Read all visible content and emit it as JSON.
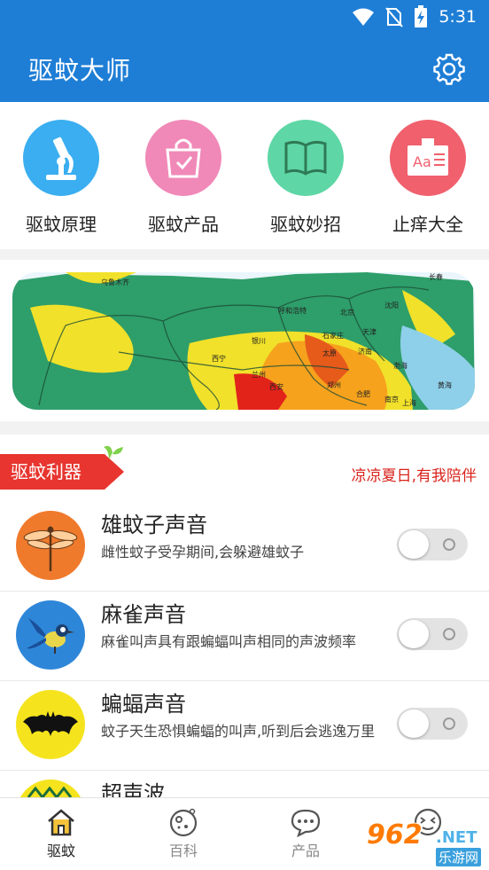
{
  "status": {
    "time": "5:31"
  },
  "app": {
    "title": "驱蚊大师"
  },
  "quick": [
    {
      "label": "驱蚊原理",
      "icon": "microscope-icon",
      "color": "#3aaef0"
    },
    {
      "label": "驱蚊产品",
      "icon": "shopping-bag-icon",
      "color": "#f089b8"
    },
    {
      "label": "驱蚊妙招",
      "icon": "book-icon",
      "color": "#5fd6a6"
    },
    {
      "label": "止痒大全",
      "icon": "text-card-icon",
      "color": "#f0606d"
    }
  ],
  "banner": {
    "labels": [
      "乌鲁木齐",
      "呼和浩特",
      "北京",
      "沈阳",
      "石家庄",
      "天津",
      "银川",
      "太原",
      "济南",
      "西宁",
      "兰州",
      "郑州",
      "西安",
      "合肥",
      "南京",
      "上海",
      "长春",
      "渤海",
      "黄海"
    ]
  },
  "section": {
    "tag": "驱蚊利器",
    "slogan": "凉凉夏日,有我陪伴"
  },
  "items": [
    {
      "title": "雄蚊子声音",
      "desc": "雌性蚊子受孕期间,会躲避雄蚊子",
      "icon": "dragonfly-icon",
      "toggle_on": false
    },
    {
      "title": "麻雀声音",
      "desc": "麻雀叫声具有跟蝙蝠叫声相同的声波频率",
      "icon": "bird-icon",
      "toggle_on": false
    },
    {
      "title": "蝙蝠声音",
      "desc": "蚊子天生恐惧蝙蝠的叫声,听到后会逃逸万里",
      "icon": "bat-icon",
      "toggle_on": false
    },
    {
      "title": "超声波",
      "desc": "",
      "icon": "ultrasound-icon",
      "toggle_on": false
    }
  ],
  "tabs": [
    {
      "label": "驱蚊",
      "icon": "home-icon",
      "active": true
    },
    {
      "label": "百科",
      "icon": "encyclopedia-icon",
      "active": false
    },
    {
      "label": "产品",
      "icon": "chat-icon",
      "active": false
    },
    {
      "label": "",
      "icon": "face-icon",
      "active": false
    }
  ],
  "watermark": {
    "number": "962",
    "suffix": ".NET",
    "name": "乐游网"
  }
}
